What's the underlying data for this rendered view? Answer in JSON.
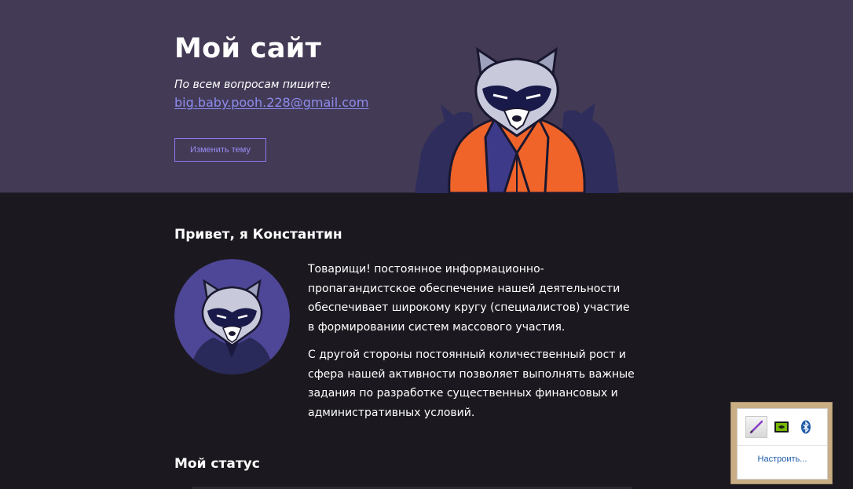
{
  "header": {
    "site_title": "Мой сайт",
    "contact_label": "По всем вопросам пишите:",
    "contact_email": "big.baby.pooh.228@gmail.com",
    "theme_button_label": "Изменить тему"
  },
  "intro": {
    "title": "Привет, я Константин",
    "paragraphs": [
      "Товарищи! постоянное информационно-пропагандистское обеспечение нашей деятельности обеспечивает широкому кругу (специалистов) участие в формировании систем массового участия.",
      "С другой стороны постоянный количественный рост и сфера нашей активности позволяет выполнять важные задания по разработке существенных финансовых и административных условий."
    ]
  },
  "status": {
    "title": "Мой статус"
  },
  "tray": {
    "icons": [
      "pen-icon",
      "nvidia-icon",
      "bluetooth-icon"
    ],
    "customize_label": "Настроить..."
  },
  "colors": {
    "header_bg": "#433a55",
    "body_bg": "#1b191f",
    "accent": "#8c8cf0",
    "jacket": "#f0642a"
  }
}
